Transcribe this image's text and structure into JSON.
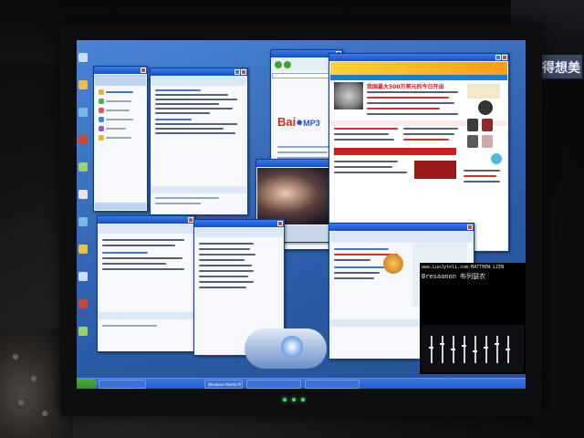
{
  "background": {
    "tv_text": "得想美",
    "colors": {
      "room": "#0c0b0a",
      "xp_blue": "#2e5fae",
      "titlebar": "#1650c8"
    }
  },
  "windows": {
    "qq_buddy_list": {
      "title": ""
    },
    "chat_window_left_top": {
      "title": ""
    },
    "browser_baidu": {
      "title": "",
      "logo": "Bai",
      "logo_suffix": "MP3"
    },
    "media_player_small": {
      "title": ""
    },
    "portal_site": {
      "title": "",
      "headline": "我国最大500万美元的今日开出",
      "tag_line": ""
    },
    "chat_window_left_bottom": {
      "title": ""
    },
    "chat_window_center": {
      "title": ""
    },
    "console": {
      "line1": "www.LuoJyteli.com-MATTHEW LIEN",
      "line2": "Bresaanon 布列瑟农"
    }
  },
  "taskbar": {
    "items": [
      "",
      "Windows Media Pl",
      "",
      ""
    ]
  }
}
